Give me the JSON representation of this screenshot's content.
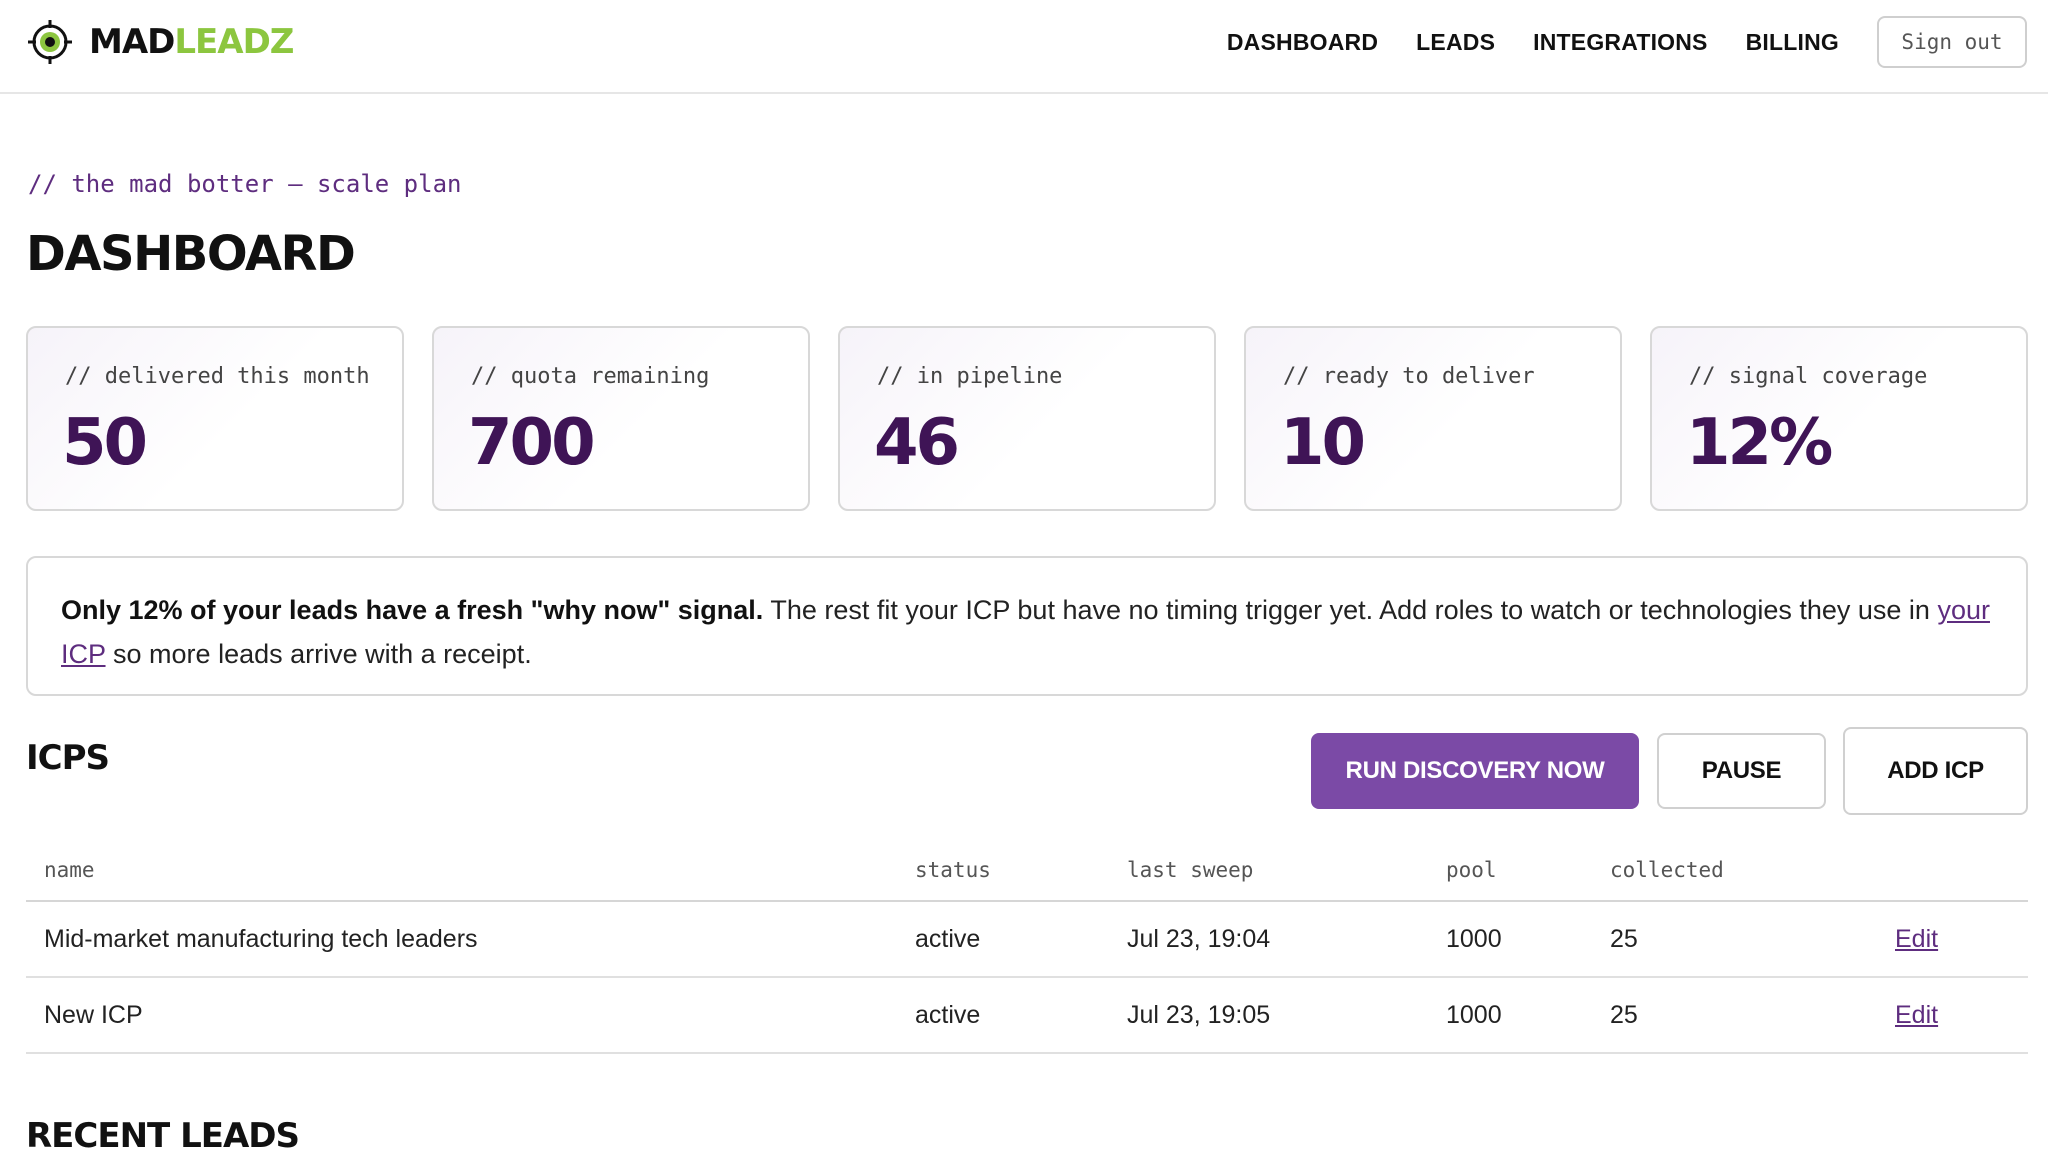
{
  "brand": {
    "name_part1": "MAD",
    "name_part2": "LEADZ",
    "accent_color": "#8cc63f",
    "icon": "crosshair-target-icon"
  },
  "nav": {
    "items": [
      {
        "label": "DASHBOARD"
      },
      {
        "label": "LEADS"
      },
      {
        "label": "INTEGRATIONS"
      },
      {
        "label": "BILLING"
      }
    ],
    "signout_label": "Sign out"
  },
  "page": {
    "breadcrumb": "// the mad botter — scale plan",
    "title": "DASHBOARD"
  },
  "stats": [
    {
      "label": "// delivered this month",
      "value": "50"
    },
    {
      "label": "// quota remaining",
      "value": "700"
    },
    {
      "label": "// in pipeline",
      "value": "46"
    },
    {
      "label": "// ready to deliver",
      "value": "10"
    },
    {
      "label": "// signal coverage",
      "value": "12%"
    }
  ],
  "notice": {
    "bold": "Only 12% of your leads have a fresh \"why now\" signal.",
    "text": " The rest fit your ICP but have no timing trigger yet. Add roles to watch or technologies they use in ",
    "link": "your ICP",
    "tail": " so more leads arrive with a receipt."
  },
  "icps": {
    "title": "ICPS",
    "buttons": {
      "run": "RUN DISCOVERY NOW",
      "pause": "PAUSE",
      "add": "ADD ICP"
    },
    "columns": {
      "name": "name",
      "status": "status",
      "last_sweep": "last sweep",
      "pool": "pool",
      "collected": "collected"
    },
    "rows": [
      {
        "name": "Mid-market manufacturing tech leaders",
        "status": "active",
        "last_sweep": "Jul 23, 19:04",
        "pool": "1000",
        "collected": "25",
        "action": "Edit"
      },
      {
        "name": "New ICP",
        "status": "active",
        "last_sweep": "Jul 23, 19:05",
        "pool": "1000",
        "collected": "25",
        "action": "Edit"
      }
    ]
  },
  "recent_leads": {
    "title": "RECENT LEADS"
  },
  "colors": {
    "primary": "#7b4aa6",
    "value_text": "#3f1456",
    "link": "#5e2d7f"
  }
}
